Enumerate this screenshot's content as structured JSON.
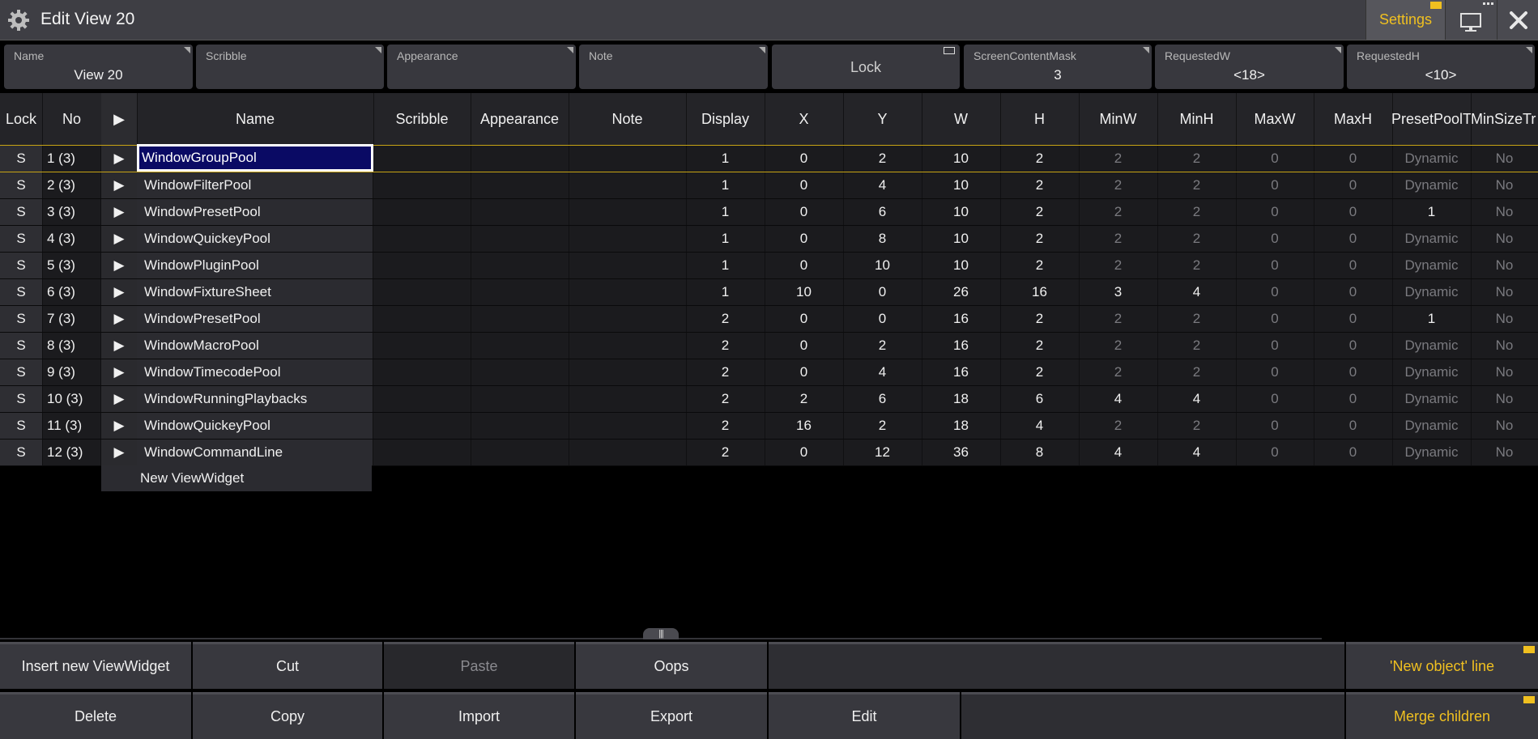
{
  "window": {
    "title": "Edit View 20",
    "settings_label": "Settings"
  },
  "fields": [
    {
      "label": "Name",
      "value": "View 20"
    },
    {
      "label": "Scribble",
      "value": ""
    },
    {
      "label": "Appearance",
      "value": ""
    },
    {
      "label": "Note",
      "value": ""
    },
    {
      "label": "",
      "value": "Lock"
    },
    {
      "label": "ScreenContentMask",
      "value": "3"
    },
    {
      "label": "RequestedW",
      "value": "<18>"
    },
    {
      "label": "RequestedH",
      "value": "<10>"
    }
  ],
  "columns": [
    "Lock",
    "No",
    "▶",
    "Name",
    "Scribble",
    "Appearance",
    "Note",
    "Display",
    "X",
    "Y",
    "W",
    "H",
    "MinW",
    "MinH",
    "MaxW",
    "MaxH",
    "PresetPoolT",
    "MinSizeTr"
  ],
  "rows": [
    {
      "lock": "S",
      "no": "1 (3)",
      "arrow": "▶",
      "name": "WindowGroupPool",
      "display": "1",
      "x": "0",
      "y": "2",
      "w": "10",
      "h": "2",
      "minw": "2",
      "minh": "2",
      "maxw": "0",
      "maxh": "0",
      "preset": "Dynamic",
      "minsize": "No"
    },
    {
      "lock": "S",
      "no": "2 (3)",
      "arrow": "▶",
      "name": "WindowFilterPool",
      "display": "1",
      "x": "0",
      "y": "4",
      "w": "10",
      "h": "2",
      "minw": "2",
      "minh": "2",
      "maxw": "0",
      "maxh": "0",
      "preset": "Dynamic",
      "minsize": "No"
    },
    {
      "lock": "S",
      "no": "3 (3)",
      "arrow": "▶",
      "name": "WindowPresetPool",
      "display": "1",
      "x": "0",
      "y": "6",
      "w": "10",
      "h": "2",
      "minw": "2",
      "minh": "2",
      "maxw": "0",
      "maxh": "0",
      "preset": "1",
      "minsize": "No"
    },
    {
      "lock": "S",
      "no": "4 (3)",
      "arrow": "▶",
      "name": "WindowQuickeyPool",
      "display": "1",
      "x": "0",
      "y": "8",
      "w": "10",
      "h": "2",
      "minw": "2",
      "minh": "2",
      "maxw": "0",
      "maxh": "0",
      "preset": "Dynamic",
      "minsize": "No"
    },
    {
      "lock": "S",
      "no": "5 (3)",
      "arrow": "▶",
      "name": "WindowPluginPool",
      "display": "1",
      "x": "0",
      "y": "10",
      "w": "10",
      "h": "2",
      "minw": "2",
      "minh": "2",
      "maxw": "0",
      "maxh": "0",
      "preset": "Dynamic",
      "minsize": "No"
    },
    {
      "lock": "S",
      "no": "6 (3)",
      "arrow": "▶",
      "name": "WindowFixtureSheet",
      "display": "1",
      "x": "10",
      "y": "0",
      "w": "26",
      "h": "16",
      "minw": "3",
      "minh": "4",
      "maxw": "0",
      "maxh": "0",
      "preset": "Dynamic",
      "minsize": "No"
    },
    {
      "lock": "S",
      "no": "7 (3)",
      "arrow": "▶",
      "name": "WindowPresetPool",
      "display": "2",
      "x": "0",
      "y": "0",
      "w": "16",
      "h": "2",
      "minw": "2",
      "minh": "2",
      "maxw": "0",
      "maxh": "0",
      "preset": "1",
      "minsize": "No"
    },
    {
      "lock": "S",
      "no": "8 (3)",
      "arrow": "▶",
      "name": "WindowMacroPool",
      "display": "2",
      "x": "0",
      "y": "2",
      "w": "16",
      "h": "2",
      "minw": "2",
      "minh": "2",
      "maxw": "0",
      "maxh": "0",
      "preset": "Dynamic",
      "minsize": "No"
    },
    {
      "lock": "S",
      "no": "9 (3)",
      "arrow": "▶",
      "name": "WindowTimecodePool",
      "display": "2",
      "x": "0",
      "y": "4",
      "w": "16",
      "h": "2",
      "minw": "2",
      "minh": "2",
      "maxw": "0",
      "maxh": "0",
      "preset": "Dynamic",
      "minsize": "No"
    },
    {
      "lock": "S",
      "no": "10 (3)",
      "arrow": "▶",
      "name": "WindowRunningPlaybacks",
      "display": "2",
      "x": "2",
      "y": "6",
      "w": "18",
      "h": "6",
      "minw": "4",
      "minh": "4",
      "maxw": "0",
      "maxh": "0",
      "preset": "Dynamic",
      "minsize": "No"
    },
    {
      "lock": "S",
      "no": "11 (3)",
      "arrow": "▶",
      "name": "WindowQuickeyPool",
      "display": "2",
      "x": "16",
      "y": "2",
      "w": "18",
      "h": "4",
      "minw": "2",
      "minh": "2",
      "maxw": "0",
      "maxh": "0",
      "preset": "Dynamic",
      "minsize": "No"
    },
    {
      "lock": "S",
      "no": "12 (3)",
      "arrow": "▶",
      "name": "WindowCommandLine",
      "display": "2",
      "x": "0",
      "y": "12",
      "w": "36",
      "h": "8",
      "minw": "4",
      "minh": "4",
      "maxw": "0",
      "maxh": "0",
      "preset": "Dynamic",
      "minsize": "No"
    }
  ],
  "new_row_label": "New ViewWidget",
  "buttons": {
    "insert": "Insert new ViewWidget",
    "cut": "Cut",
    "paste": "Paste",
    "oops": "Oops",
    "new_object_line": "'New object' line",
    "delete": "Delete",
    "copy": "Copy",
    "import": "Import",
    "export": "Export",
    "edit": "Edit",
    "merge_children": "Merge children"
  },
  "colors": {
    "accent": "#f0c020",
    "selection": "#0a0a64"
  }
}
